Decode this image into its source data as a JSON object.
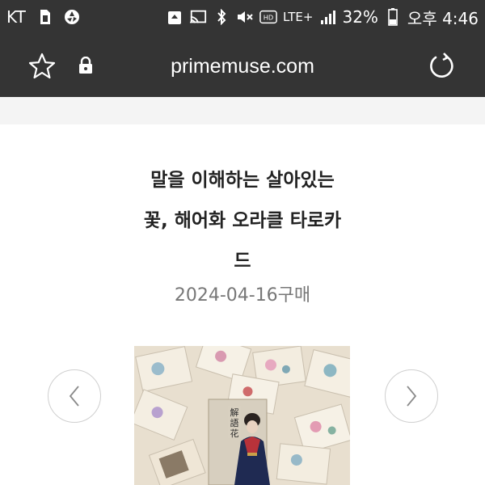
{
  "status_bar": {
    "carrier": "KT",
    "network": "LTE+",
    "battery_percent": "32%",
    "time": "오후 4:46",
    "icons": [
      "sim-icon",
      "aperture-icon",
      "recycle-icon",
      "cast-icon",
      "bluetooth-icon",
      "mute-icon",
      "hd-icon",
      "signal-icon",
      "battery-icon"
    ]
  },
  "toolbar": {
    "url": "primemuse.com",
    "icons": [
      "star-icon",
      "lock-icon",
      "reload-icon"
    ]
  },
  "product": {
    "title_lines": [
      "말을 이해하는 살아있는",
      "꽃, 해어화 오라클 타로카",
      "드"
    ],
    "date": "2024-04-16구매",
    "image_text": "解語花"
  },
  "carousel": {
    "prev_icon": "chevron-left-icon",
    "next_icon": "chevron-right-icon"
  },
  "colors": {
    "bar_bg": "#343434",
    "band_bg": "#f4f4f4",
    "date_color": "#777777"
  }
}
